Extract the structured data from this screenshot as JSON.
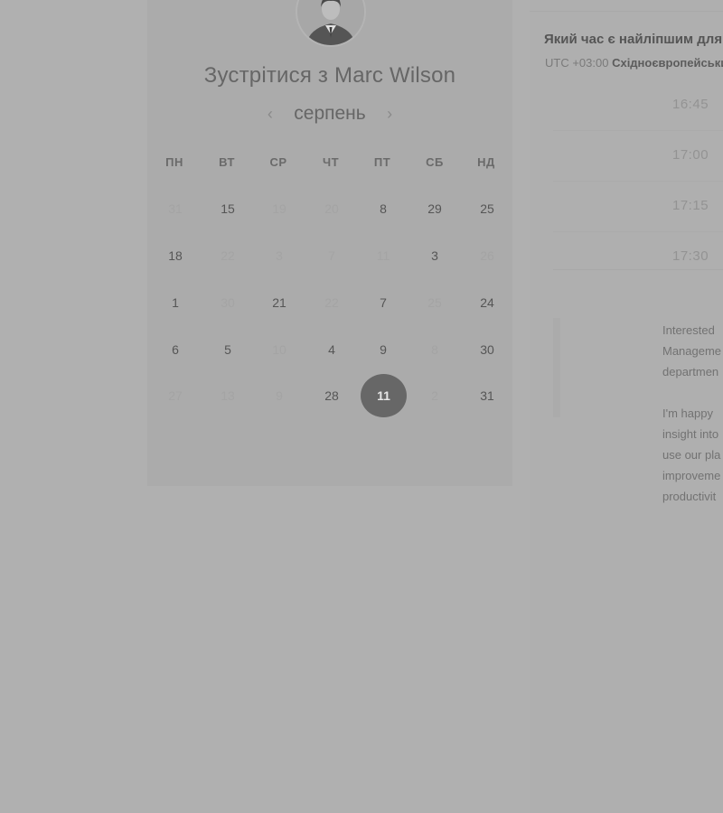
{
  "meeting": {
    "title": "Зустрітися з Marc Wilson"
  },
  "calendar": {
    "month": "серпень",
    "prev_icon": "chevron-left-icon",
    "next_icon": "chevron-right-icon",
    "weekdays": [
      "ПН",
      "ВТ",
      "СР",
      "ЧТ",
      "ПТ",
      "СБ",
      "НД"
    ],
    "weeks": [
      [
        {
          "d": "31",
          "available": false
        },
        {
          "d": "15",
          "available": true
        },
        {
          "d": "19",
          "available": false
        },
        {
          "d": "20",
          "available": false
        },
        {
          "d": "8",
          "available": true
        },
        {
          "d": "29",
          "available": true
        },
        {
          "d": "25",
          "available": true
        }
      ],
      [
        {
          "d": "18",
          "available": true
        },
        {
          "d": "22",
          "available": false
        },
        {
          "d": "3",
          "available": false
        },
        {
          "d": "7",
          "available": false
        },
        {
          "d": "11",
          "available": false
        },
        {
          "d": "3",
          "available": true
        },
        {
          "d": "26",
          "available": false
        }
      ],
      [
        {
          "d": "1",
          "available": true
        },
        {
          "d": "30",
          "available": false
        },
        {
          "d": "21",
          "available": true
        },
        {
          "d": "22",
          "available": false
        },
        {
          "d": "7",
          "available": true
        },
        {
          "d": "25",
          "available": false
        },
        {
          "d": "24",
          "available": true
        }
      ],
      [
        {
          "d": "6",
          "available": true
        },
        {
          "d": "5",
          "available": true
        },
        {
          "d": "10",
          "available": false
        },
        {
          "d": "4",
          "available": true
        },
        {
          "d": "9",
          "available": true
        },
        {
          "d": "8",
          "available": false
        },
        {
          "d": "30",
          "available": true
        }
      ],
      [
        {
          "d": "27",
          "available": false
        },
        {
          "d": "13",
          "available": false
        },
        {
          "d": "9",
          "available": false
        },
        {
          "d": "28",
          "available": true
        },
        {
          "d": "11",
          "available": true,
          "selected": true
        },
        {
          "d": "2",
          "available": false
        },
        {
          "d": "31",
          "available": true
        }
      ]
    ]
  },
  "schedule": {
    "question": "Який час є найліпшим для",
    "timezone_offset": "UTC +03:00",
    "timezone_name": "Східноєвропейський",
    "slots": [
      "16:45",
      "17:00",
      "17:15",
      "17:30"
    ]
  },
  "description": {
    "paragraph1": [
      "Interested",
      "Manageme",
      "departmen"
    ],
    "paragraph2": [
      "I'm happy",
      "insight into",
      "use our pla",
      "improveme",
      "productivit"
    ]
  },
  "colors": {
    "overlay": "#b0b0b0",
    "selected_day": "#676767"
  }
}
